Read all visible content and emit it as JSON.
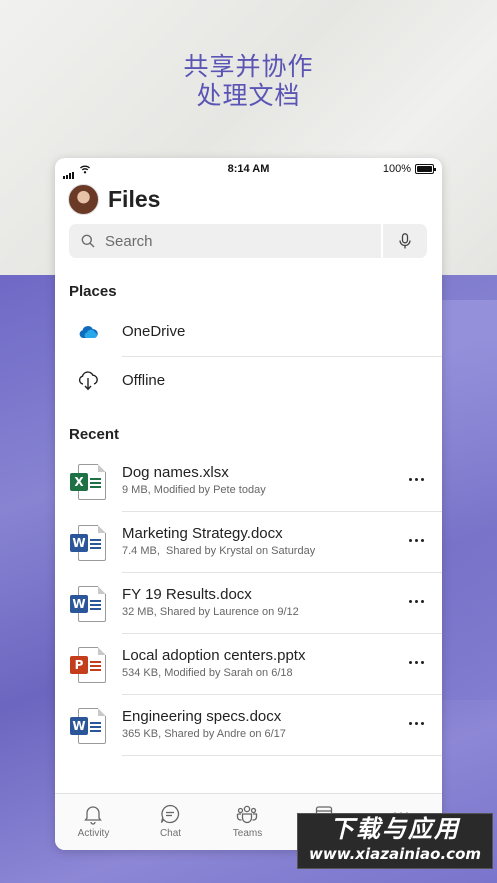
{
  "promo": {
    "line1": "共享并协作",
    "line2": "处理文档"
  },
  "status_bar": {
    "time": "8:14 AM",
    "battery": "100%",
    "battery_level": 1.0
  },
  "header": {
    "title": "Files"
  },
  "search": {
    "placeholder": "Search"
  },
  "places": {
    "heading": "Places",
    "items": [
      {
        "label": "OneDrive",
        "icon": "onedrive-cloud-icon"
      },
      {
        "label": "Offline",
        "icon": "cloud-download-icon"
      }
    ]
  },
  "recent": {
    "heading": "Recent",
    "files": [
      {
        "name": "Dog names.xlsx",
        "meta": "9 MB, Modified by Pete today",
        "type": "excel",
        "badge": "X",
        "color": "#1e7145"
      },
      {
        "name": "Marketing Strategy.docx",
        "meta": "7.4 MB,  Shared by Krystal on Saturday",
        "type": "word",
        "badge": "W",
        "color": "#2b579a"
      },
      {
        "name": "FY 19 Results.docx",
        "meta": "32 MB, Shared by Laurence on 9/12",
        "type": "word",
        "badge": "W",
        "color": "#2b579a"
      },
      {
        "name": "Local adoption centers.pptx",
        "meta": "534 KB, Modified by Sarah on 6/18",
        "type": "powerpoint",
        "badge": "P",
        "color": "#c43e1c"
      },
      {
        "name": "Engineering specs.docx",
        "meta": "365 KB, Shared by Andre on 6/17",
        "type": "word",
        "badge": "W",
        "color": "#2b579a"
      }
    ]
  },
  "tabbar": {
    "tabs": [
      {
        "label": "Activity",
        "icon": "bell-icon"
      },
      {
        "label": "Chat",
        "icon": "chat-icon"
      },
      {
        "label": "Teams",
        "icon": "teams-icon"
      },
      {
        "label": "",
        "icon": "calendar-icon"
      },
      {
        "label": "",
        "icon": "more-icon"
      }
    ]
  },
  "watermark": {
    "line1": "下载与应用",
    "line2": "www.xiazainiao.com"
  },
  "colors": {
    "promo_text": "#5a55b5",
    "purple_bg": "#7a74cc",
    "onedrive_blue": "#0f6cbd"
  }
}
